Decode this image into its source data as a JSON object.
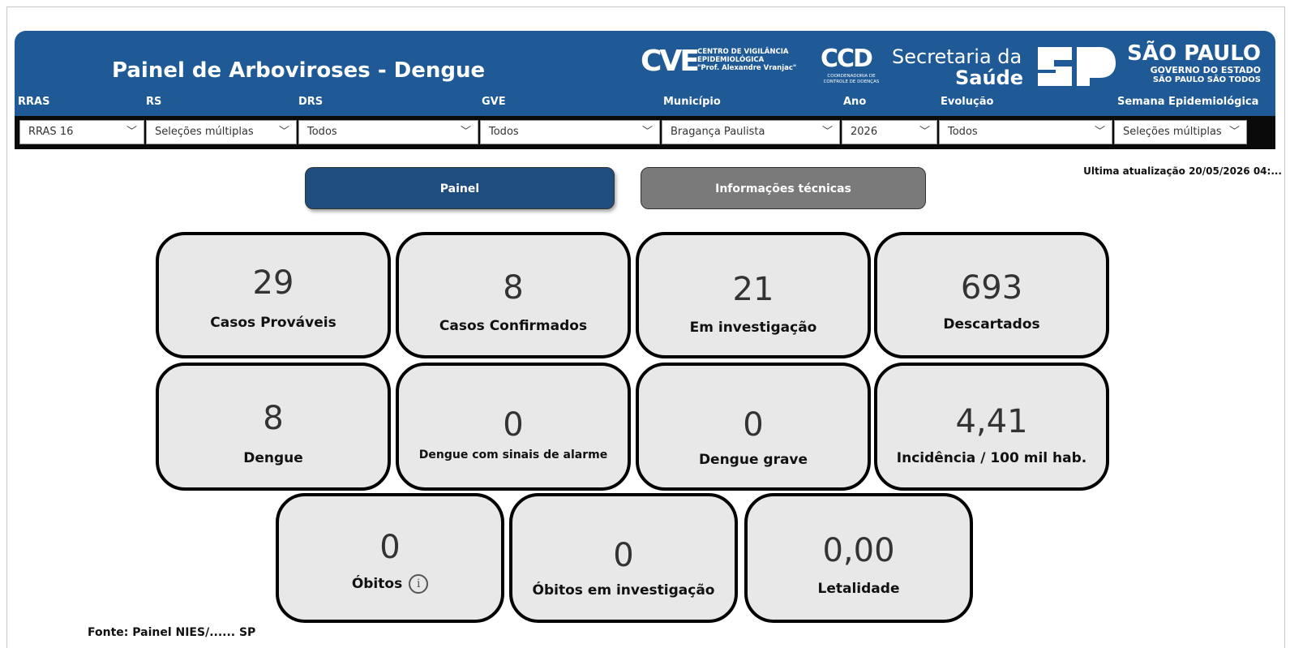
{
  "header": {
    "title": "Painel de Arboviroses - Dengue",
    "logos": {
      "cve_big": "CVE",
      "cve_small": [
        "CENTRO DE VIGILÂNCIA",
        "EPIDEMIOLÓGICA",
        "\"Prof. Alexandre Vranjac\""
      ],
      "ccd_big": "CCD",
      "ccd_small": [
        "COORDENADORIA DE",
        "CONTROLE DE DOENÇAS"
      ],
      "sec_line1": "Secretaria da",
      "sec_line2": "Saúde",
      "sp_line1": "SÃO PAULO",
      "sp_line2": "GOVERNO DO ESTADO",
      "sp_line3": "SÃO PAULO SÃO TODOS"
    }
  },
  "filters": [
    {
      "label": "RRAS",
      "value": "RRAS 16"
    },
    {
      "label": "RS",
      "value": "Seleções múltiplas"
    },
    {
      "label": "DRS",
      "value": "Todos"
    },
    {
      "label": "GVE",
      "value": "Todos"
    },
    {
      "label": "Município",
      "value": "Bragança Paulista"
    },
    {
      "label": "Ano",
      "value": "2026"
    },
    {
      "label": "Evolução",
      "value": "Todos"
    },
    {
      "label": "Semana Epidemiológica",
      "value": "Seleções múltiplas"
    }
  ],
  "last_update": "Ultima atualização 20/05/2026 04:...",
  "tabs": {
    "painel": "Painel",
    "info": "Informações técnicas"
  },
  "cards": {
    "casos_provaveis": {
      "value": "29",
      "label": "Casos Prováveis"
    },
    "casos_confirmados": {
      "value": "8",
      "label": "Casos Confirmados"
    },
    "em_investigacao": {
      "value": "21",
      "label": "Em investigação"
    },
    "descartados": {
      "value": "693",
      "label": "Descartados"
    },
    "dengue": {
      "value": "8",
      "label": "Dengue"
    },
    "dengue_alarme": {
      "value": "0",
      "label": "Dengue com sinais de alarme"
    },
    "dengue_grave": {
      "value": "0",
      "label": "Dengue grave"
    },
    "incidencia": {
      "value": "4,41",
      "label": "Incidência / 100 mil hab."
    },
    "obitos": {
      "value": "0",
      "label": "Óbitos",
      "info_icon": "i"
    },
    "obitos_investigacao": {
      "value": "0",
      "label": "Óbitos em investigação"
    },
    "letalidade": {
      "value": "0,00",
      "label": "Letalidade"
    }
  },
  "footer": "Fonte: Painel NIES/...... SP"
}
